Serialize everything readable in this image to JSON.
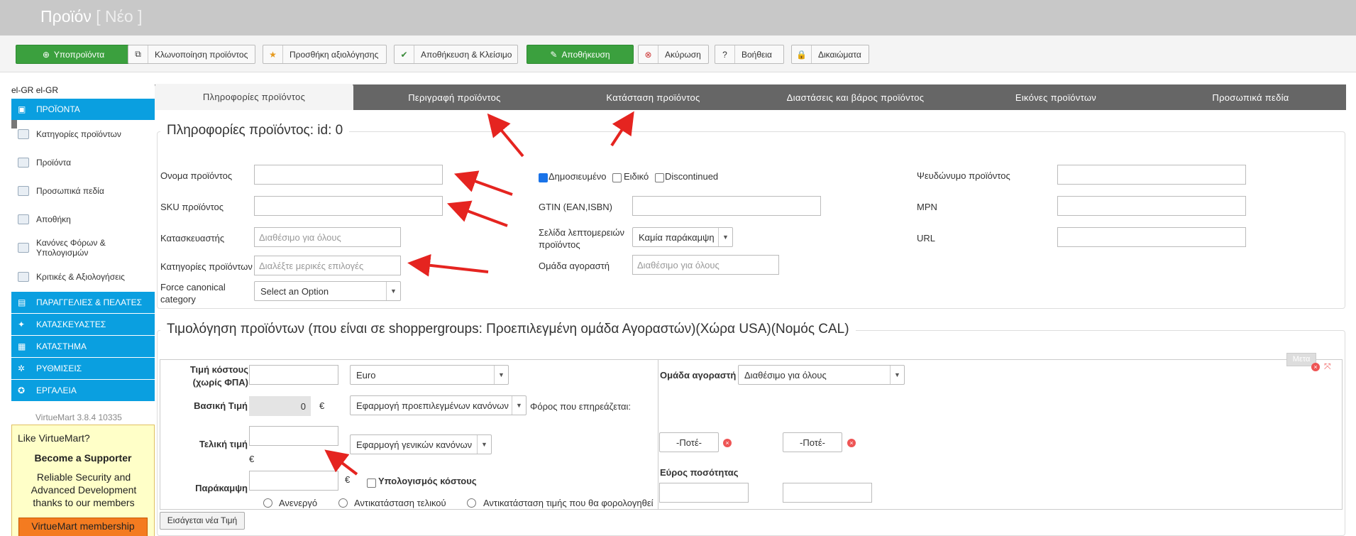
{
  "header": {
    "title": "Προϊόν",
    "subtitle": "[ Νέο ]"
  },
  "toolbar": {
    "subproducts": "Υποπροϊόντα",
    "clone": "Κλωνοποίηση προϊόντος",
    "add_rating": "Προσθήκη αξιολόγησης",
    "save_close": "Αποθήκευση & Κλείσιμο",
    "save": "Αποθήκευση",
    "cancel": "Ακύρωση",
    "help": "Βοήθεια",
    "permissions": "Δικαιώματα"
  },
  "sidebar": {
    "lang": "el-GR",
    "lang2": "el-GR",
    "sections": [
      "ΠΡΟΪΟΝΤΑ",
      "ΠΑΡΑΓΓΕΛΙΕΣ & ΠΕΛΑΤΕΣ",
      "ΚΑΤΑΣΚΕΥΑΣΤΕΣ",
      "ΚΑΤΑΣΤΗΜΑ",
      "ΡΥΘΜΙΣΕΙΣ",
      "ΕΡΓΑΛΕΙΑ"
    ],
    "items": [
      "Κατηγορίες προϊόντων",
      "Προϊόντα",
      "Προσωπικά πεδία",
      "Αποθήκη",
      "Κανόνες Φόρων & Υπολογισμών",
      "Κριτικές & Αξιολογήσεις"
    ],
    "version": "VirtueMart 3.8.4 10335",
    "ad": {
      "line1": "Like VirtueMart?",
      "line2": "Become a Supporter",
      "line3": "Reliable Security and Advanced Development thanks to our members",
      "button": "VirtueMart membership"
    }
  },
  "tabs": [
    "Πληροφορίες προϊόντος",
    "Περιγραφή προϊόντος",
    "Κατάσταση προϊόντος",
    "Διαστάσεις και βάρος προϊόντος",
    "Εικόνες προϊόντων",
    "Προσωπικά πεδία"
  ],
  "info": {
    "legend": "Πληροφορίες προϊόντος: id: 0",
    "name_label": "Ονομα προϊόντος",
    "sku_label": "SKU προϊόντος",
    "manufacturer_label": "Κατασκευαστής",
    "manufacturer_ph": "Διαθέσιμο για όλους",
    "categories_label": "Κατηγορίες προϊόντων",
    "categories_ph": "Διαλέξτε μερικές επιλογές",
    "canonical_label": "Force canonical category",
    "canonical_value": "Select an Option",
    "published": "Δημοσιευμένο",
    "special": "Ειδικό",
    "discontinued": "Discontinued",
    "gtin_label": "GTIN (EAN,ISBN)",
    "detail_label": "Σελίδα λεπτομερειών προϊόντος",
    "detail_value": "Καμία παράκαμψη",
    "group_label": "Ομάδα αγοραστή",
    "group_ph": "Διαθέσιμο για όλους",
    "alias_label": "Ψευδώνυμο προϊόντος",
    "mpn_label": "MPN",
    "url_label": "URL"
  },
  "pricing": {
    "legend": "Τιμολόγηση προϊόντων (που είναι σε shoppergroups: Προεπιλεγμένη ομάδα Αγοραστών)(Χώρα USA)(Νομός CAL)",
    "cost_label": "Τιμή κόστους (χωρίς ΦΠΑ)",
    "currency": "Euro",
    "base_label": "Βασική Τιμή",
    "base_value": "0",
    "euro": "€",
    "rules_default": "Εφαρμογή προεπιλεγμένων κανόνων",
    "tax_affects": "Φόρος που επηρεάζεται:",
    "final_label": "Τελική τιμή",
    "rules_general": "Εφαρμογή γενικών κανόνων",
    "override_label": "Παράκαμψη",
    "calc_cost": "Υπολογισμός κόστους",
    "radio1": "Ανενεργό",
    "radio2": "Αντικατάσταση τελικού",
    "radio3": "Αντικατάσταση τιμής που θα φορολογηθεί",
    "buyer_group_label": "Ομάδα αγοραστή",
    "buyer_group_value": "Διαθέσιμο για όλους",
    "never1": "-Ποτέ-",
    "never2": "-Ποτέ-",
    "qty_range": "Εύρος ποσότητας",
    "new_price_btn": "Εισάγεται νέα Τιμή",
    "move_label": "Μετα"
  }
}
